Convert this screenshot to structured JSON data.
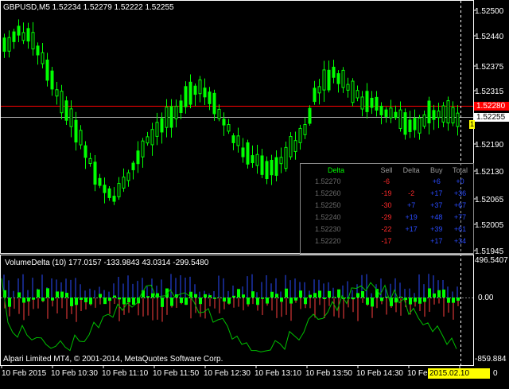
{
  "symbol_title": "GBPUSD,M5  1.52234 1.52279 1.52222 1.52255",
  "price_axis": {
    "labels": [
      "1.52500",
      "1.52440",
      "1.52375",
      "1.52315",
      "1.52255",
      "1.52190",
      "1.52130",
      "1.52065",
      "1.52005",
      "1.51945"
    ],
    "red_line_price": "1.52280",
    "current_price": "1.52255",
    "marker": "1"
  },
  "indicator": {
    "title": "VolumeDelta (10) 177.0157 -133.9843 43.0314 -299.5480",
    "scale_max": "496.5407",
    "scale_zero": "0.00",
    "scale_min": "-859.884"
  },
  "copyright": "Alpari Limited MT4, © 2001-2014, MetaQuotes Software Corp.",
  "time_axis": {
    "labels": [
      "10 Feb 2015",
      "10 Feb 10:30",
      "10 Feb 11:10",
      "10 Feb 11:50",
      "10 Feb 12:30",
      "10 Feb 13:10",
      "10 Feb 13:50",
      "10 Feb 14:30",
      "10 Feb 15"
    ],
    "cursor_time": "2015.02.10 15:50",
    "trailing": "0"
  },
  "panel": {
    "headers": [
      "Delta",
      "Sell",
      "Delta",
      "Buy",
      "Total"
    ],
    "rows": [
      {
        "price": "1.52270",
        "sell": "-6",
        "delta": "",
        "buy": "+6",
        "total": "+0"
      },
      {
        "price": "1.52260",
        "sell": "-19",
        "delta": "-2",
        "buy": "+17",
        "total": "+36"
      },
      {
        "price": "1.52250",
        "sell": "-30",
        "delta": "+7",
        "buy": "+37",
        "total": "+67"
      },
      {
        "price": "1.52240",
        "sell": "-29",
        "delta": "+19",
        "buy": "+48",
        "total": "+77"
      },
      {
        "price": "1.52230",
        "sell": "-22",
        "delta": "+17",
        "buy": "+39",
        "total": "+61"
      },
      {
        "price": "1.52220",
        "sell": "-17",
        "delta": "",
        "buy": "+17",
        "total": "+34"
      }
    ]
  },
  "colors": {
    "bull": "#00ff00",
    "bear": "#000000",
    "wick": "#00ff00",
    "red_line": "#ff0000",
    "price_line": "#b0b0b0",
    "delta_pos": "#2a4bff",
    "delta_neg": "#ff4040",
    "hist_pos": "#00ff00",
    "ind_line": "#00c000"
  }
}
